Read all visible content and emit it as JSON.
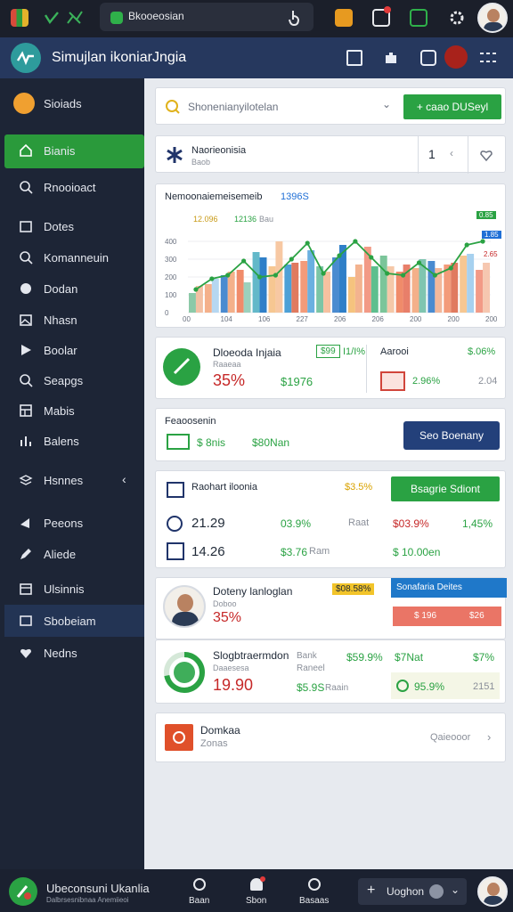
{
  "system_bar": {
    "tab_label": "Bkooeosian",
    "colors": {
      "bg": "#1b1f2a"
    }
  },
  "header": {
    "app_title": "Simujlan ikoniarJngia"
  },
  "sidebar": {
    "items": [
      {
        "label": "Sioiads",
        "icon": "orange-coin-icon"
      },
      {
        "label": "Bianis",
        "icon": "home-icon"
      },
      {
        "label": "Rnooioact",
        "icon": "search-icon"
      },
      {
        "label": "Dotes",
        "icon": "calendar-icon"
      },
      {
        "label": "Komanneuin",
        "icon": "user-search-icon"
      },
      {
        "label": "Dodan",
        "icon": "chat-icon"
      },
      {
        "label": "Nhasn",
        "icon": "image-icon"
      },
      {
        "label": "Boolar",
        "icon": "play-icon"
      },
      {
        "label": "Seapgs",
        "icon": "search-icon"
      },
      {
        "label": "Mabis",
        "icon": "grid-icon"
      },
      {
        "label": "Balens",
        "icon": "chart-icon"
      },
      {
        "label": "Hsnnes",
        "icon": "layers-icon"
      },
      {
        "label": "Peeons",
        "icon": "megaphone-icon"
      },
      {
        "label": "Aliede",
        "icon": "pen-icon"
      },
      {
        "label": "Ulsinnis",
        "icon": "table-icon"
      },
      {
        "label": "Sbobeiam",
        "icon": "folder-icon"
      },
      {
        "label": "Nedns",
        "icon": "heart-icon"
      }
    ]
  },
  "search": {
    "value": "Shonenianyilotelan",
    "button_label": "+ caao DUSeyl"
  },
  "info_card": {
    "title": "Naorieonisia",
    "subtitle": "Baob",
    "count": "1"
  },
  "chart_card": {
    "title": "Nemoonaiemeisemeib",
    "highlight": "1396S",
    "label_a": "12.096",
    "label_b": "12136",
    "label_b_suffix": "Bau",
    "tag_a": "0.85",
    "tag_b": "1.85",
    "tag_c": "2.65"
  },
  "chart_data": {
    "type": "bar",
    "categories": [
      "00",
      "104",
      "106",
      "227",
      "206",
      "206",
      "200",
      "200",
      "200"
    ],
    "yticks": [
      "0",
      "100",
      "200",
      "300",
      "400"
    ],
    "ylim": [
      0,
      500
    ],
    "series": [
      {
        "values": [
          110,
          160,
          210,
          240,
          340,
          260,
          270,
          290,
          260,
          310,
          200,
          370,
          320,
          230,
          250,
          290,
          270,
          320,
          240
        ]
      },
      {
        "values": [
          150,
          190,
          230,
          170,
          310,
          400,
          280,
          350,
          230,
          380,
          270,
          260,
          260,
          270,
          300,
          250,
          280,
          330,
          280
        ]
      }
    ],
    "line": [
      130,
      190,
      210,
      290,
      200,
      210,
      300,
      390,
      220,
      320,
      400,
      310,
      220,
      210,
      280,
      210,
      250,
      380,
      400
    ]
  },
  "stats_card_1": {
    "title": "Dloeoda Injaia",
    "subtitle": "Raaeaa",
    "percent": "35%",
    "value_green": "$1976",
    "badge": "$99",
    "badge_text": "I1/I%",
    "right_label": "Aarooi",
    "right_value": "$.06%",
    "right_pct": "2.96%",
    "right_num": "2.04"
  },
  "stats_card_2": {
    "title": "Feaoosenin",
    "value_a": "$ 8nis",
    "value_b": "$80Nan",
    "button_label": "Seo Boenany"
  },
  "stats_card_3": {
    "title": "Raohart iloonia",
    "badge_value": "$3.5%",
    "button_label": "Bsagrie Sdiont",
    "row1": {
      "value": "21.29",
      "pct": "03.9%",
      "label": "Raat",
      "money": "$03.9%",
      "right": "1,45%"
    },
    "row2": {
      "value": "14.26",
      "money": "$3.76",
      "label": "Ram",
      "right": "$ 10.00en"
    }
  },
  "profile_card": {
    "name": "Doteny lanloglan",
    "badge": "$08.58%",
    "percent": "35%",
    "subtitle": "Doboo",
    "banner_label": "Sonafaria Deites",
    "red_a": "$ 196",
    "red_b": "$26"
  },
  "progress_card": {
    "title": "Slogbtraermdon",
    "subtitle": "Daaesesa",
    "value": "19.90",
    "col_label_a": "Bank",
    "col_label_b": "Raneel",
    "col_value_a": "$59.9%",
    "money": "$5.9S",
    "money_label": "Raain",
    "right_title": "$7Nat",
    "right_pct": "$7%",
    "right_green": "95.9%",
    "right_num": "2151",
    "progress_fraction": 0.72
  },
  "footer_card": {
    "title": "Domkaa",
    "subtitle": "Zonas",
    "link_label": "Qaieooor"
  },
  "bottom_bar": {
    "title": "Ubeconsuni Ukanlia",
    "subtitle": "Dalbrsesnibnaa Anemiieoi",
    "nav": [
      "Baan",
      "Sbon",
      "Basaas"
    ],
    "search_label": "Uoghon"
  }
}
